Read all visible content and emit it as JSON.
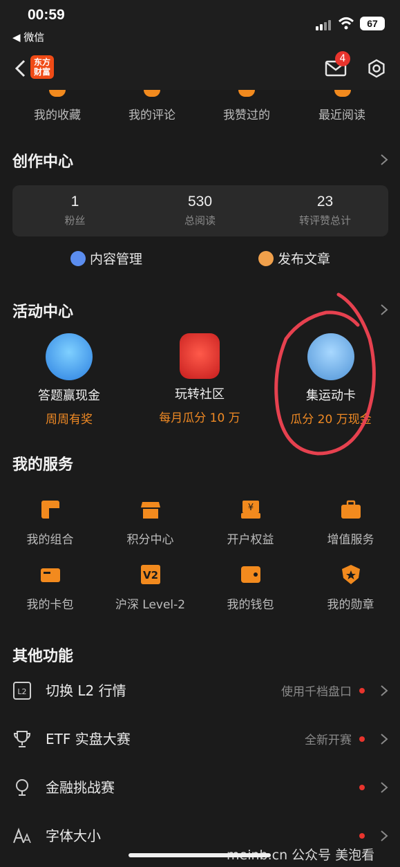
{
  "status": {
    "time": "00:59",
    "back_app": "◀ 微信",
    "battery": "67"
  },
  "nav": {
    "logo_line1": "东方",
    "logo_line2": "财富",
    "mail_badge": "4"
  },
  "favorites": [
    "我的收藏",
    "我的评论",
    "我赞过的",
    "最近阅读"
  ],
  "creation": {
    "title": "创作中心",
    "stats": [
      {
        "value": "1",
        "label": "粉丝"
      },
      {
        "value": "530",
        "label": "总阅读"
      },
      {
        "value": "23",
        "label": "转评赞总计"
      }
    ],
    "links": [
      "内容管理",
      "发布文章"
    ]
  },
  "activities": {
    "title": "活动中心",
    "items": [
      {
        "title": "答题赢现金",
        "sub": "周周有奖"
      },
      {
        "title": "玩转社区",
        "sub": "每月瓜分 10 万"
      },
      {
        "title": "集运动卡",
        "sub": "瓜分 20 万现金"
      }
    ]
  },
  "services": {
    "title": "我的服务",
    "items": [
      "我的组合",
      "积分中心",
      "开户权益",
      "增值服务",
      "我的卡包",
      "沪深 Level-2",
      "我的钱包",
      "我的勋章"
    ]
  },
  "other": {
    "title": "其他功能",
    "items": [
      {
        "label": "切换 L2 行情",
        "hint": "使用千档盘口"
      },
      {
        "label": "ETF 实盘大赛",
        "hint": "全新开赛"
      },
      {
        "label": "金融挑战赛",
        "hint": ""
      },
      {
        "label": "字体大小",
        "hint": ""
      }
    ]
  },
  "watermark": "meinb.cn  公众号 美泡看",
  "colors": {
    "accent": "#f08a24",
    "background": "#1b1b1b",
    "badge": "#e8342d",
    "annotation_circle": "#e6414f"
  }
}
